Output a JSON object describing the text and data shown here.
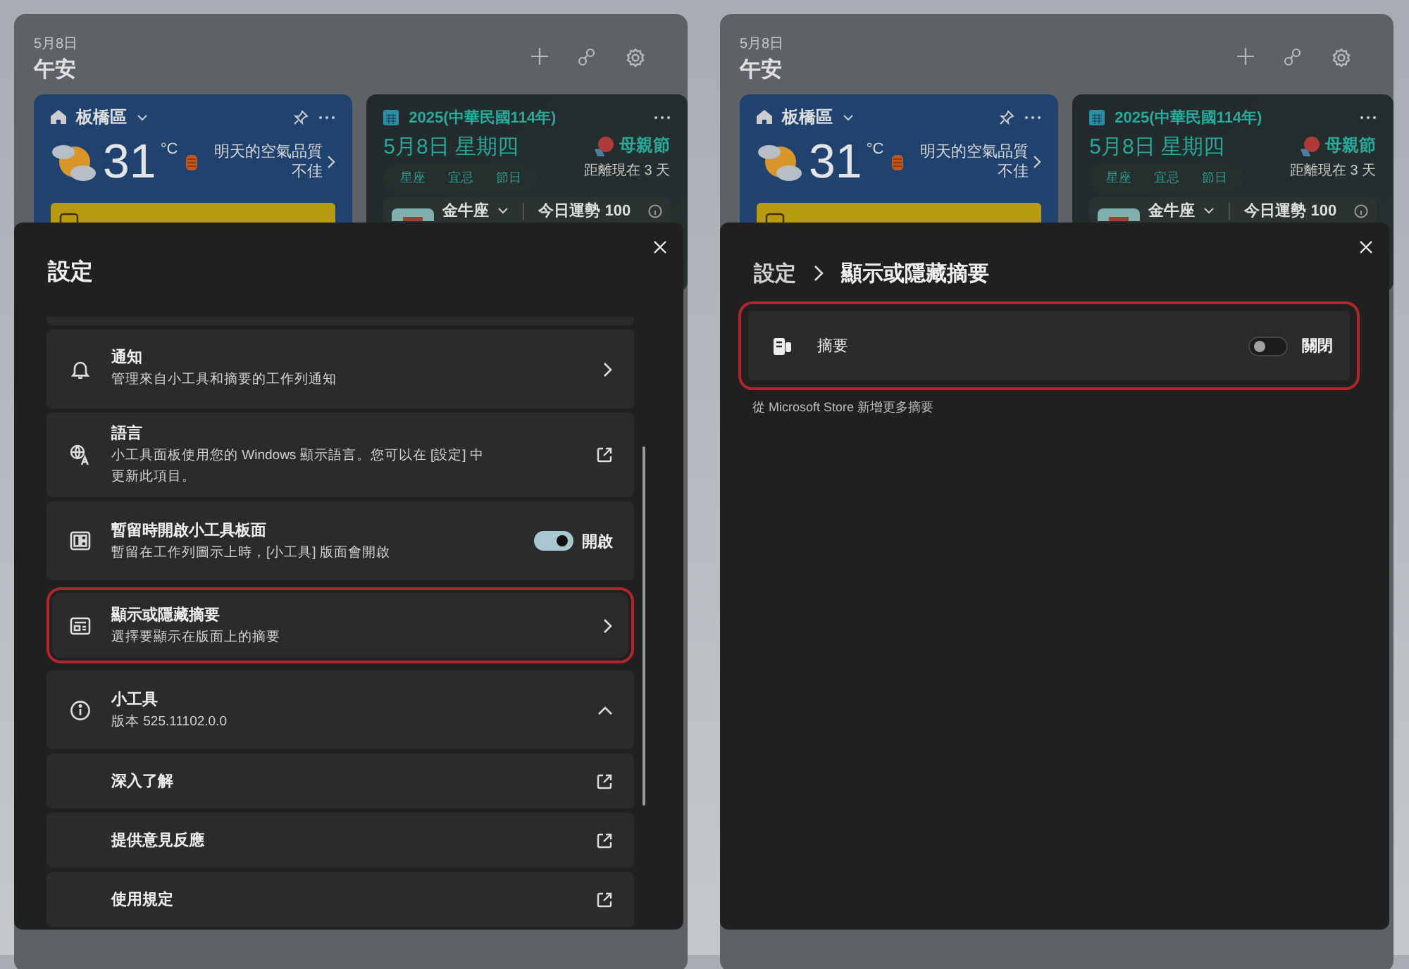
{
  "panels": [
    {
      "board": {
        "date": "5月8日",
        "greeting": "午安",
        "weather": {
          "location": "板橋區",
          "temperature": "31",
          "unit": "°C",
          "air_quality": "明天的空氣品質不佳"
        },
        "calendar": {
          "year": "2025(中華民國114年)",
          "date": "5月8日 星期四",
          "tabs": [
            "星座",
            "宜忌",
            "節日"
          ],
          "holiday": "母親節",
          "countdown": "距離現在 3 天",
          "zodiac": "金牛座",
          "fortune": "今日運勢 100"
        }
      },
      "dialog": {
        "kind": "list",
        "title": "設定",
        "items": [
          {
            "kind": "nav",
            "title": "通知",
            "description": "管理來自小工具和摘要的工作列通知",
            "highlighted": false
          },
          {
            "kind": "external",
            "title": "語言",
            "description": "小工具面板使用您的 Windows 顯示語言。您可以在 [設定] 中更新此項目。",
            "highlighted": false
          },
          {
            "kind": "toggle",
            "title": "暫留時開啟小工具板面",
            "description": "暫留在工作列圖示上時，[小工具] 版面會開啟",
            "on": true,
            "state_label": "開啟",
            "highlighted": false
          },
          {
            "kind": "nav",
            "title": "顯示或隱藏摘要",
            "description": "選擇要顯示在版面上的摘要",
            "highlighted": true
          },
          {
            "kind": "expander",
            "title": "小工具",
            "description": "版本 525.11102.0.0",
            "expanded": true,
            "highlighted": false,
            "children": [
              {
                "title": "深入了解"
              },
              {
                "title": "提供意見反應"
              },
              {
                "title": "使用規定"
              }
            ]
          }
        ]
      }
    },
    {
      "board": {
        "date": "5月8日",
        "greeting": "午安",
        "weather": {
          "location": "板橋區",
          "temperature": "31",
          "unit": "°C",
          "air_quality": "明天的空氣品質不佳"
        },
        "calendar": {
          "year": "2025(中華民國114年)",
          "date": "5月8日 星期四",
          "tabs": [
            "星座",
            "宜忌",
            "節日"
          ],
          "holiday": "母親節",
          "countdown": "距離現在 3 天",
          "zodiac": "金牛座",
          "fortune": "今日運勢 100"
        }
      },
      "dialog": {
        "kind": "detail",
        "breadcrumb": [
          "設定",
          "顯示或隱藏摘要"
        ],
        "rows": [
          {
            "title": "摘要",
            "on": false,
            "state_label": "關閉",
            "highlighted": true
          }
        ],
        "footer_link": "從 Microsoft Store 新增更多摘要"
      }
    }
  ]
}
